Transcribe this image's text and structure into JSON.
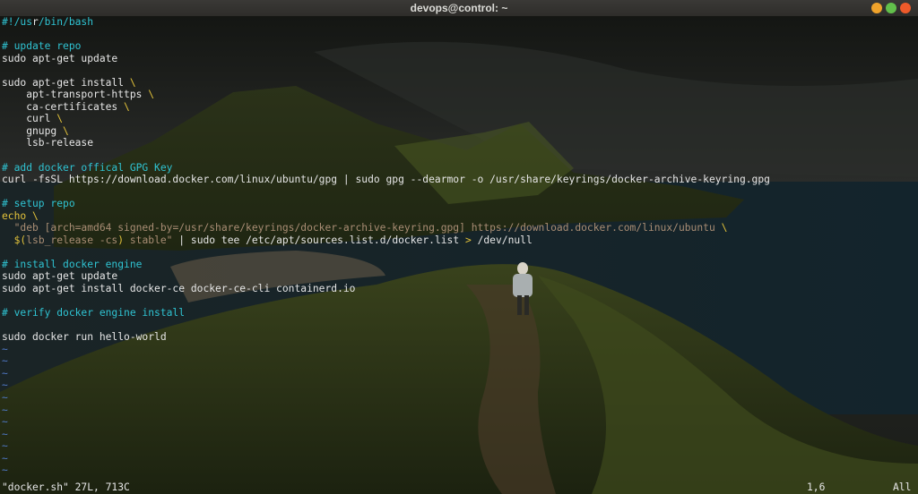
{
  "window": {
    "title": "devops@control: ~",
    "buttons": {
      "minimize": "minimize-icon",
      "maximize": "maximize-icon",
      "close": "close-icon"
    }
  },
  "editor": {
    "lines": [
      [
        {
          "t": "shebang",
          "v": "#!/us"
        },
        {
          "t": "cursor",
          "v": "r"
        },
        {
          "t": "shebang",
          "v": "/bin/bash"
        }
      ],
      [],
      [
        {
          "t": "comment",
          "v": "# update repo"
        }
      ],
      [
        {
          "t": "plain",
          "v": "sudo apt-get update"
        }
      ],
      [],
      [
        {
          "t": "plain",
          "v": "sudo apt-get install "
        },
        {
          "t": "cont",
          "v": "\\"
        }
      ],
      [
        {
          "t": "plain",
          "v": "    apt-transport-https "
        },
        {
          "t": "cont",
          "v": "\\"
        }
      ],
      [
        {
          "t": "plain",
          "v": "    ca-certificates "
        },
        {
          "t": "cont",
          "v": "\\"
        }
      ],
      [
        {
          "t": "plain",
          "v": "    curl "
        },
        {
          "t": "cont",
          "v": "\\"
        }
      ],
      [
        {
          "t": "plain",
          "v": "    gnupg "
        },
        {
          "t": "cont",
          "v": "\\"
        }
      ],
      [
        {
          "t": "plain",
          "v": "    lsb-release"
        }
      ],
      [],
      [
        {
          "t": "comment",
          "v": "# add docker offical GPG Key"
        }
      ],
      [
        {
          "t": "plain",
          "v": "curl -fsSL https://download.docker.com/linux/ubuntu/gpg | sudo gpg --dearmor -o /usr/share/keyrings/docker-archive-keyring.gpg"
        }
      ],
      [],
      [
        {
          "t": "comment",
          "v": "# setup repo"
        }
      ],
      [
        {
          "t": "keyword",
          "v": "echo"
        },
        {
          "t": "plain",
          "v": " "
        },
        {
          "t": "cont",
          "v": "\\"
        }
      ],
      [
        {
          "t": "plain",
          "v": "  "
        },
        {
          "t": "string",
          "v": "\"deb [arch=amd64 signed-by=/usr/share/keyrings/docker-archive-keyring.gpg] https://download.docker.com/linux/ubuntu "
        },
        {
          "t": "cont",
          "v": "\\"
        }
      ],
      [
        {
          "t": "plain",
          "v": "  "
        },
        {
          "t": "op",
          "v": "$("
        },
        {
          "t": "string",
          "v": "lsb_release -cs"
        },
        {
          "t": "op",
          "v": ")"
        },
        {
          "t": "string",
          "v": " stable\""
        },
        {
          "t": "plain",
          "v": " | sudo tee /etc/apt/sources.list.d/docker.list "
        },
        {
          "t": "op",
          "v": ">"
        },
        {
          "t": "plain",
          "v": " /dev/null"
        }
      ],
      [],
      [
        {
          "t": "comment",
          "v": "# install docker engine"
        }
      ],
      [
        {
          "t": "plain",
          "v": "sudo apt-get update"
        }
      ],
      [
        {
          "t": "plain",
          "v": "sudo apt-get install docker-ce docker-ce-cli containerd.io"
        }
      ],
      [],
      [
        {
          "t": "comment",
          "v": "# verify docker engine install"
        }
      ],
      [],
      [
        {
          "t": "plain",
          "v": "sudo docker run hello-world"
        }
      ]
    ],
    "tilde": "~",
    "tilde_count": 11
  },
  "status": {
    "file_info": "\"docker.sh\" 27L, 713C",
    "cursor_pos": "1,6",
    "scroll": "All"
  },
  "colors": {
    "comment": "#2fc3d2",
    "continuation": "#e2c23a",
    "string": "#a98d74",
    "tilde": "#4f79c7"
  }
}
